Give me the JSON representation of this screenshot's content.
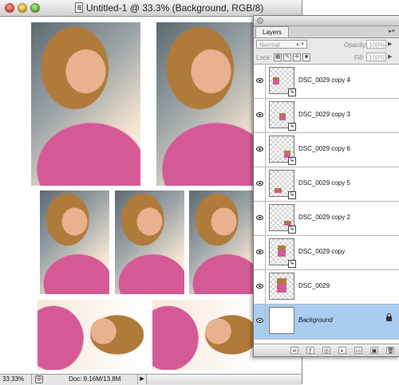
{
  "document": {
    "title": "Untitled-1 @ 33.3% (Background, RGB/8)",
    "zoom": "33.33%",
    "doc_size": "Doc: 9.16M/13.8M"
  },
  "layers_panel": {
    "tab_label": "Layers",
    "blend_mode": "Normal",
    "opacity_label": "Opacity:",
    "opacity_value": "100%",
    "lock_label": "Lock:",
    "fill_label": "Fill:",
    "fill_value": "100%",
    "layers": [
      {
        "name": "DSC_0029 copy 4",
        "visible": true,
        "selected": false
      },
      {
        "name": "DSC_0029 copy 3",
        "visible": true,
        "selected": false
      },
      {
        "name": "DSC_0029 copy 6",
        "visible": true,
        "selected": false
      },
      {
        "name": "DSC_0029 copy 5",
        "visible": true,
        "selected": false
      },
      {
        "name": "DSC_0029 copy 2",
        "visible": true,
        "selected": false
      },
      {
        "name": "DSC_0029 copy",
        "visible": true,
        "selected": false
      },
      {
        "name": "DSC_0029",
        "visible": true,
        "selected": false
      },
      {
        "name": "Background",
        "visible": true,
        "selected": true,
        "locked": true
      }
    ],
    "bottom_tools": [
      "link-icon",
      "fx-icon",
      "mask-icon",
      "adjustment-icon",
      "folder-icon",
      "new-layer-icon",
      "trash-icon"
    ]
  },
  "colors": {
    "selected_layer": "#a9cdf0",
    "photo_top": "#d45a96"
  }
}
